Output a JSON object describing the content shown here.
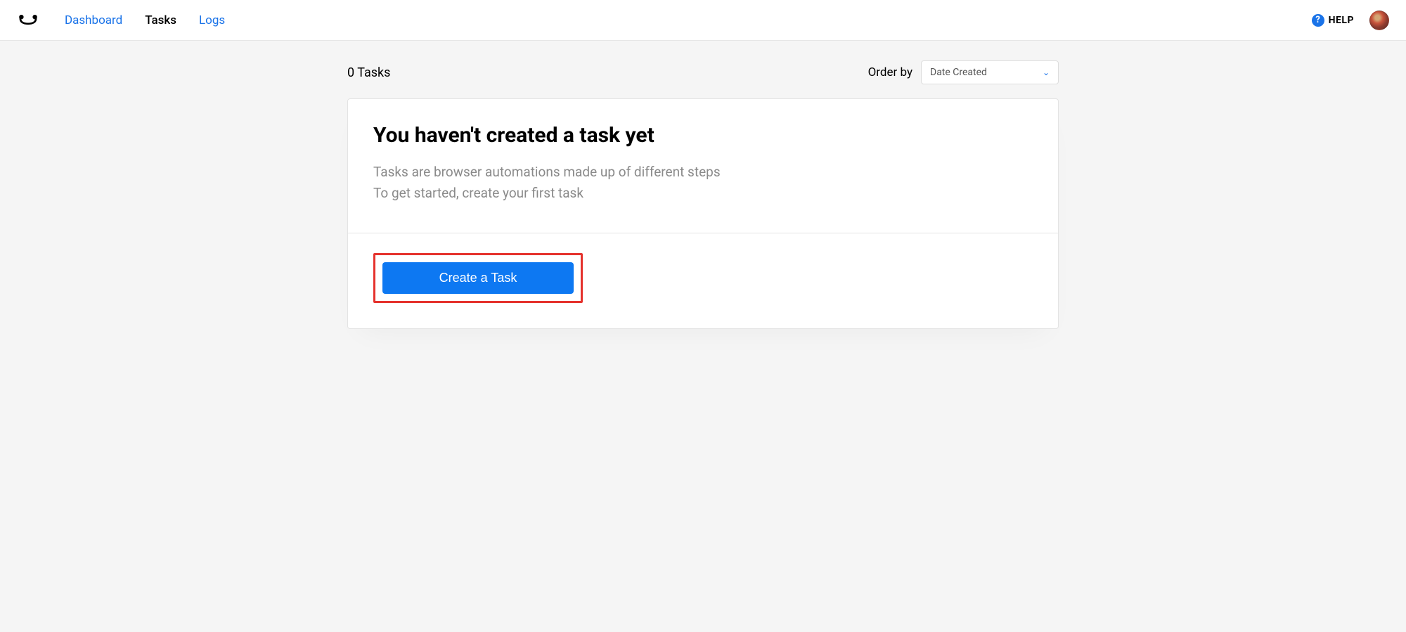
{
  "header": {
    "nav": {
      "dashboard": "Dashboard",
      "tasks": "Tasks",
      "logs": "Logs"
    },
    "help_label": "HELP"
  },
  "toolbar": {
    "task_count": "0 Tasks",
    "order_by_label": "Order by",
    "order_select_value": "Date Created"
  },
  "empty_state": {
    "title": "You haven't created a task yet",
    "desc_line1": "Tasks are browser automations made up of different steps",
    "desc_line2": "To get started, create your first task",
    "create_button": "Create a Task"
  }
}
